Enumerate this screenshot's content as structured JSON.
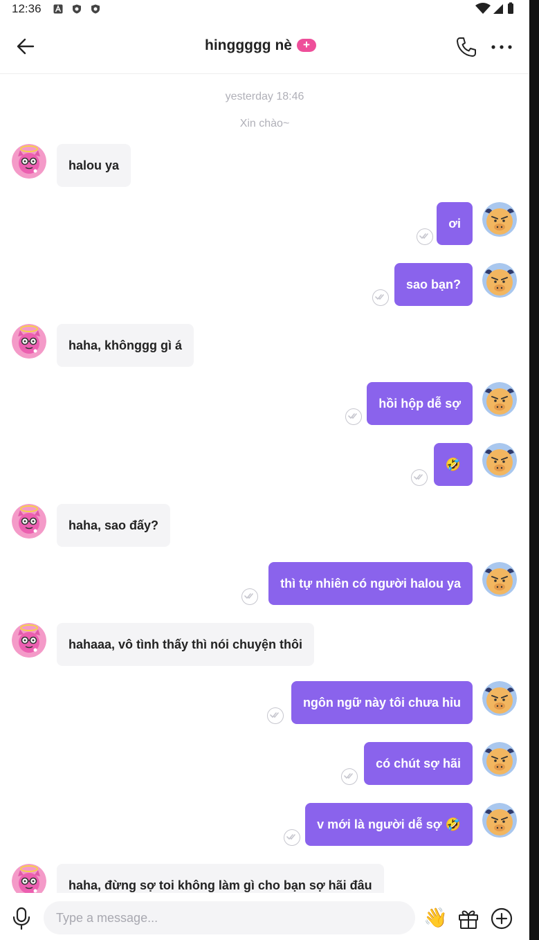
{
  "status_bar": {
    "time": "12:36",
    "notification_icons": [
      "a-icon",
      "shield-icon",
      "shield-icon"
    ],
    "right_icons": [
      "wifi-icon",
      "signal-icon",
      "battery-icon"
    ]
  },
  "header": {
    "title": "hinggggg nè",
    "badge": "+",
    "icons": [
      "back-arrow-icon",
      "phone-icon",
      "more-dots-icon"
    ]
  },
  "chat": {
    "date_label": "yesterday 18:46",
    "greeting": "Xin chào~",
    "messages": [
      {
        "side": "in",
        "text": "halou ya"
      },
      {
        "side": "out",
        "text": "ơi"
      },
      {
        "side": "out",
        "text": "sao bạn?"
      },
      {
        "side": "in",
        "text": "haha, khônggg gì á"
      },
      {
        "side": "out",
        "text": "hồi hộp dễ sợ"
      },
      {
        "side": "out",
        "text": "🤣"
      },
      {
        "side": "in",
        "text": "haha, sao đấy?"
      },
      {
        "side": "out",
        "text": "thì tự nhiên có người  halou ya"
      },
      {
        "side": "in",
        "text": "hahaaa, vô tình thấy thì nói chuyện thôi"
      },
      {
        "side": "out",
        "text": "ngôn ngữ này tôi chưa hỉu"
      },
      {
        "side": "out",
        "text": "có chút sợ hãi"
      },
      {
        "side": "out",
        "text": "v mới là người dễ sợ 🤣"
      },
      {
        "side": "in",
        "text": "haha, đừng sợ  toi không làm gì cho bạn sợ hãi đâu"
      }
    ]
  },
  "composer": {
    "placeholder": "Type a message...",
    "wave_emoji": "👋",
    "icons": [
      "microphone-icon",
      "gift-icon",
      "add-circle-icon"
    ]
  },
  "colors": {
    "outgoing_bubble": "#8a63ec",
    "incoming_bubble": "#f4f4f6",
    "badge": "#ee4f9a",
    "timestamp_text": "#b0b0b8"
  }
}
